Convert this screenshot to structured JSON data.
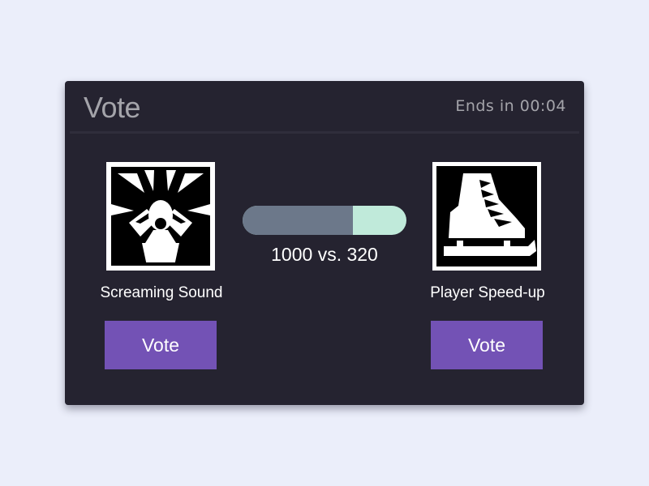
{
  "header": {
    "title": "Vote",
    "timer": "Ends in 00:04"
  },
  "options": [
    {
      "label": "Screaming Sound",
      "button_label": "Vote",
      "votes": 1000,
      "icon": "screaming-person-icon"
    },
    {
      "label": "Player Speed-up",
      "button_label": "Vote",
      "votes": 320,
      "icon": "ice-skate-icon"
    }
  ],
  "tally": {
    "text": "1000 vs. 320",
    "left_share": 0.6757
  },
  "colors": {
    "panel": "#252330",
    "button": "#7352b5",
    "bar_left": "#6c788a",
    "bar_right": "#c0eada"
  }
}
